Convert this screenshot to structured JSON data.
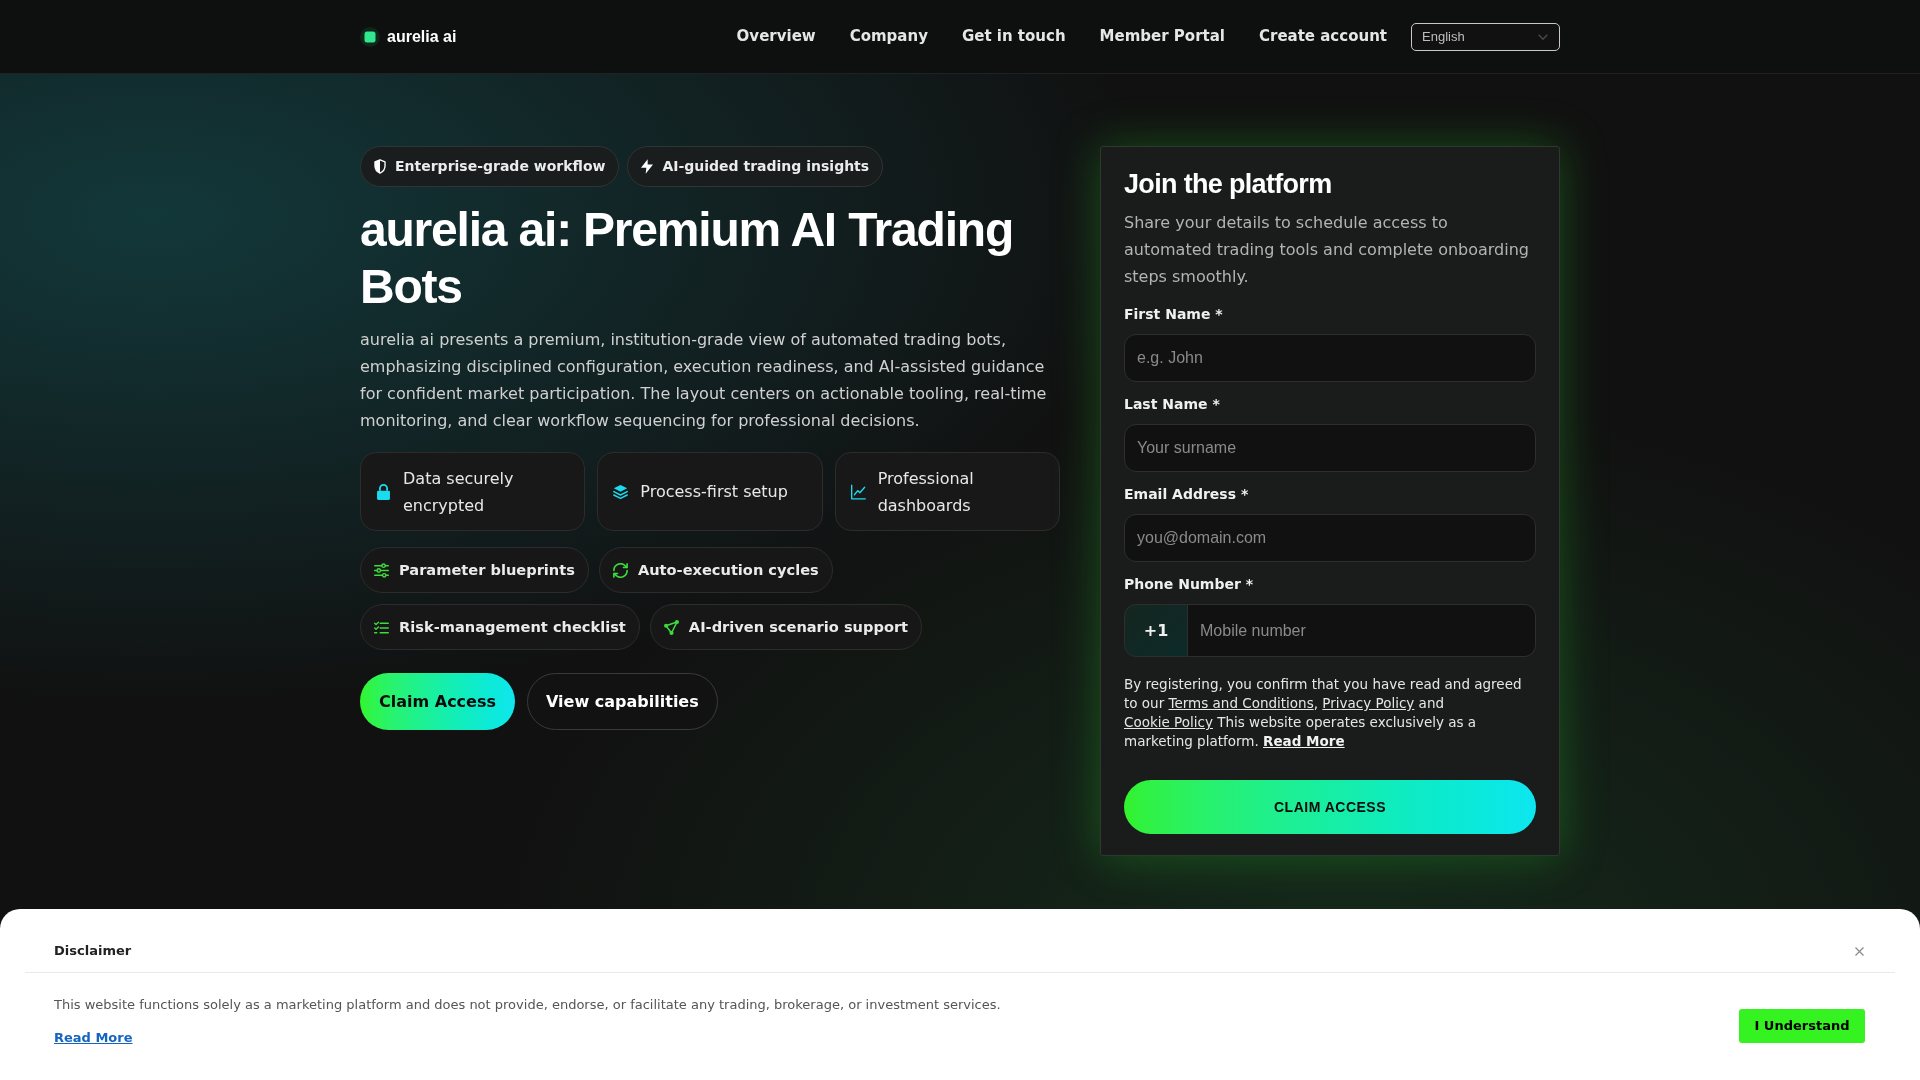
{
  "header": {
    "logo": "aurelia ai",
    "nav": [
      "Overview",
      "Company",
      "Get in touch",
      "Member Portal",
      "Create account"
    ],
    "language": "English"
  },
  "hero": {
    "badges": [
      "Enterprise-grade workflow",
      "AI-guided trading insights"
    ],
    "title": "aurelia ai: Premium AI Trading Bots",
    "intro": "aurelia ai presents a premium, institution-grade view of automated trading bots, emphasizing disciplined configuration, execution readiness, and AI-assisted guidance for confident market participation. The layout centers on actionable tooling, real-time monitoring, and clear workflow sequencing for professional decisions.",
    "features": [
      "Data securely encrypted",
      "Process-first setup",
      "Professional dashboards"
    ],
    "capabilities": [
      "Parameter blueprints",
      "Auto-execution cycles",
      "Risk-management checklist",
      "AI-driven scenario support"
    ],
    "actions": [
      {
        "label": "Claim Access",
        "kind": "primary"
      },
      {
        "label": "View capabilities",
        "kind": "secondary"
      }
    ]
  },
  "form": {
    "title": "Join the platform",
    "description": "Share your details to schedule access to automated trading tools and complete onboarding steps smoothly.",
    "fields": [
      {
        "kind": "text",
        "label": "First Name *",
        "placeholder": "e.g. John"
      },
      {
        "kind": "text",
        "label": "Last Name *",
        "placeholder": "Your surname"
      },
      {
        "kind": "text",
        "label": "Email Address *",
        "placeholder": "you@domain.com"
      },
      {
        "kind": "phone",
        "label": "Phone Number *",
        "prefix": "+1",
        "placeholder": "Mobile number"
      }
    ],
    "consent": [
      {
        "kind": "text",
        "text": "By registering, you confirm that you have read and agreed to our "
      },
      {
        "kind": "link",
        "text": "Terms and Conditions"
      },
      {
        "kind": "text",
        "text": ", "
      },
      {
        "kind": "link",
        "text": "Privacy Policy"
      },
      {
        "kind": "text",
        "text": " and "
      },
      {
        "kind": "link",
        "text": "Cookie Policy"
      },
      {
        "kind": "text",
        "text": " This website operates exclusively as a marketing platform. "
      },
      {
        "kind": "bold-link",
        "text": "Read More"
      }
    ],
    "submit": "CLAIM ACCESS"
  },
  "disclaimer": {
    "title": "Disclaimer",
    "text": "This website functions solely as a marketing platform and does not provide, endorse, or facilitate any trading, brokerage, or investment services.",
    "link": "Read More",
    "button": "I Understand"
  }
}
